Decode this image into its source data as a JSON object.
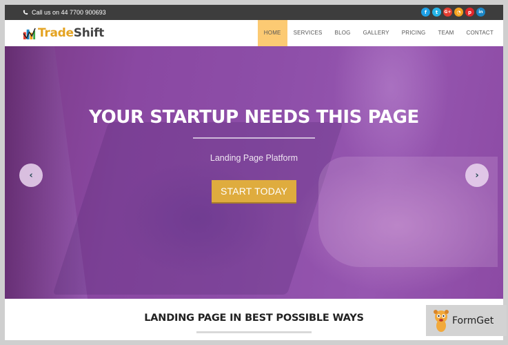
{
  "topbar": {
    "call_text": "Call us on 44 7700 900693",
    "social": [
      {
        "icon": "facebook-icon",
        "glyph": "f",
        "color": "#1ea0e6"
      },
      {
        "icon": "twitter-icon",
        "glyph": "t",
        "color": "#26b4e8"
      },
      {
        "icon": "google-plus-icon",
        "glyph": "G+",
        "color": "#e53c31"
      },
      {
        "icon": "rss-icon",
        "glyph": "◔",
        "color": "#f6a21d"
      },
      {
        "icon": "pinterest-icon",
        "glyph": "p",
        "color": "#e0262a"
      },
      {
        "icon": "linkedin-icon",
        "glyph": "in",
        "color": "#1b86c6"
      }
    ]
  },
  "brand": {
    "name_part1": "Trade",
    "name_part2": "Shift"
  },
  "nav": {
    "items": [
      {
        "label": "HOME",
        "active": true
      },
      {
        "label": "SERVICES",
        "active": false
      },
      {
        "label": "BLOG",
        "active": false
      },
      {
        "label": "GALLERY",
        "active": false
      },
      {
        "label": "PRICING",
        "active": false
      },
      {
        "label": "TEAM",
        "active": false
      },
      {
        "label": "CONTACT",
        "active": false
      }
    ]
  },
  "hero": {
    "title": "YOUR STARTUP NEEDS THIS PAGE",
    "subtitle": "Landing Page Platform",
    "cta_label": "START TODAY",
    "prev_glyph": "‹",
    "next_glyph": "›"
  },
  "section": {
    "title": "LANDING PAGE IN BEST POSSIBLE WAYS"
  },
  "watermark": {
    "name": "FormGet"
  },
  "colors": {
    "accent": "#dfac3e",
    "nav_active": "#fcca73",
    "topbar": "#3d3d3d",
    "hero_overlay": "#8d4ea8"
  }
}
